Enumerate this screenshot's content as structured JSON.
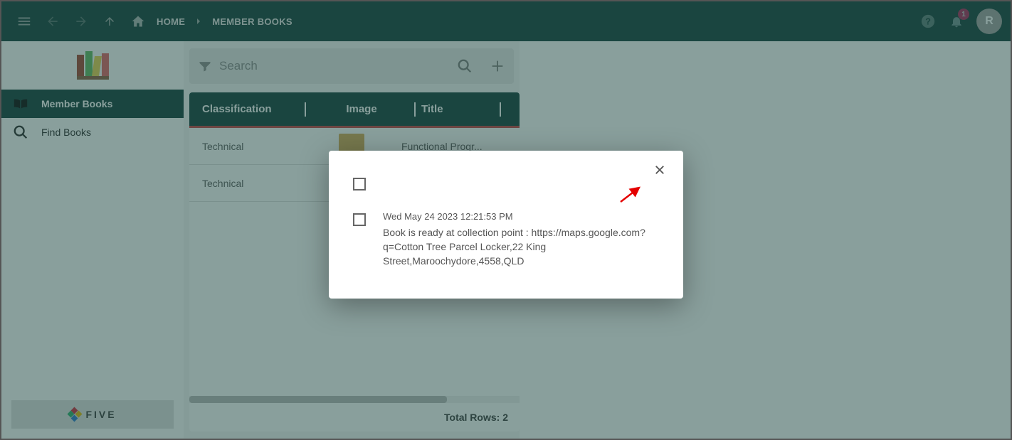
{
  "topbar": {
    "home_label": "HOME",
    "breadcrumb": "MEMBER BOOKS",
    "badge_count": "1",
    "avatar_initial": "R"
  },
  "sidebar": {
    "items": [
      {
        "label": "Member Books"
      },
      {
        "label": "Find Books"
      }
    ],
    "footer_brand": "FIVE"
  },
  "search": {
    "placeholder": "Search"
  },
  "table": {
    "headers": {
      "classification": "Classification",
      "image": "Image",
      "title": "Title"
    },
    "rows": [
      {
        "classification": "Technical",
        "title": "Functional Progr..."
      },
      {
        "classification": "Technical",
        "title": ""
      }
    ],
    "footer_label": "Total Rows:",
    "footer_count": "2"
  },
  "modal": {
    "notifications": [
      {
        "date": "",
        "body": ""
      },
      {
        "date": "Wed May 24 2023 12:21:53 PM",
        "body": "Book is ready at collection point : https://maps.google.com?q=Cotton Tree Parcel Locker,22 King Street,Maroochydore,4558,QLD"
      }
    ]
  }
}
